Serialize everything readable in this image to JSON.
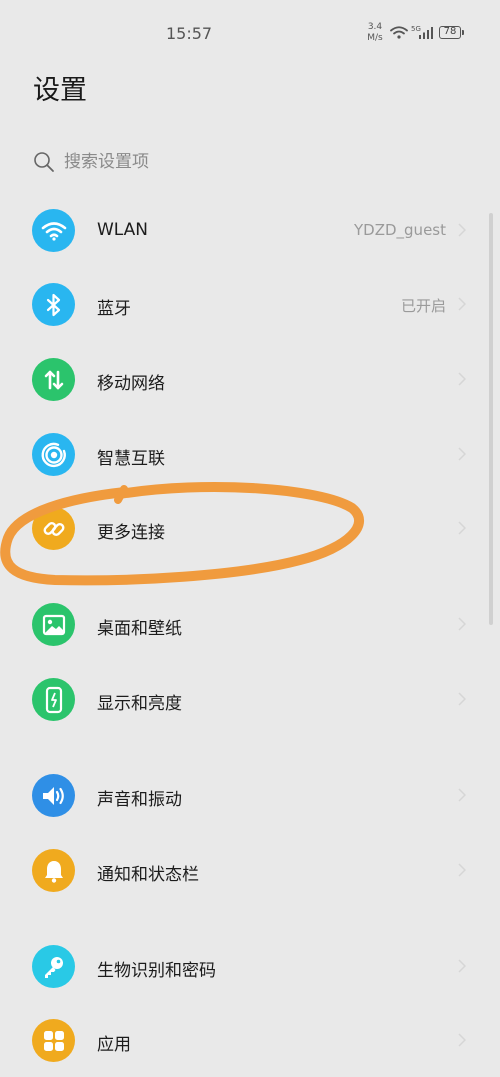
{
  "status_bar": {
    "time": "15:57",
    "speed_value": "3.4",
    "speed_unit": "M/s",
    "network": "5G",
    "battery": "78"
  },
  "page": {
    "title": "设置"
  },
  "search": {
    "placeholder": "搜索设置项"
  },
  "colors": {
    "background": "#e9e9e9",
    "wlan": "#29b6f0",
    "bluetooth": "#29b6f0",
    "mobile_network": "#2bc46c",
    "smart_connect": "#29b6f0",
    "more_connections": "#f0aa1e",
    "wallpaper": "#2bc46c",
    "display": "#2bc46c",
    "sound": "#2f8fe6",
    "notifications": "#f0aa1e",
    "biometrics": "#29c9e6",
    "apps": "#f0aa1e",
    "annotation": "#f09b3e"
  },
  "menu": {
    "wlan": {
      "label": "WLAN",
      "value": "YDZD_guest",
      "icon": "wifi-icon"
    },
    "bluetooth": {
      "label": "蓝牙",
      "value": "已开启",
      "icon": "bluetooth-icon"
    },
    "mobile_network": {
      "label": "移动网络",
      "icon": "data-arrows-icon"
    },
    "smart_connect": {
      "label": "智慧互联",
      "icon": "radar-icon"
    },
    "more_connections": {
      "label": "更多连接",
      "icon": "link-icon"
    },
    "wallpaper": {
      "label": "桌面和壁纸",
      "icon": "image-icon"
    },
    "display": {
      "label": "显示和亮度",
      "icon": "phone-brightness-icon"
    },
    "sound": {
      "label": "声音和振动",
      "icon": "speaker-icon"
    },
    "notifications": {
      "label": "通知和状态栏",
      "icon": "bell-icon"
    },
    "biometrics": {
      "label": "生物识别和密码",
      "icon": "key-icon"
    },
    "apps": {
      "label": "应用",
      "icon": "apps-grid-icon"
    }
  }
}
